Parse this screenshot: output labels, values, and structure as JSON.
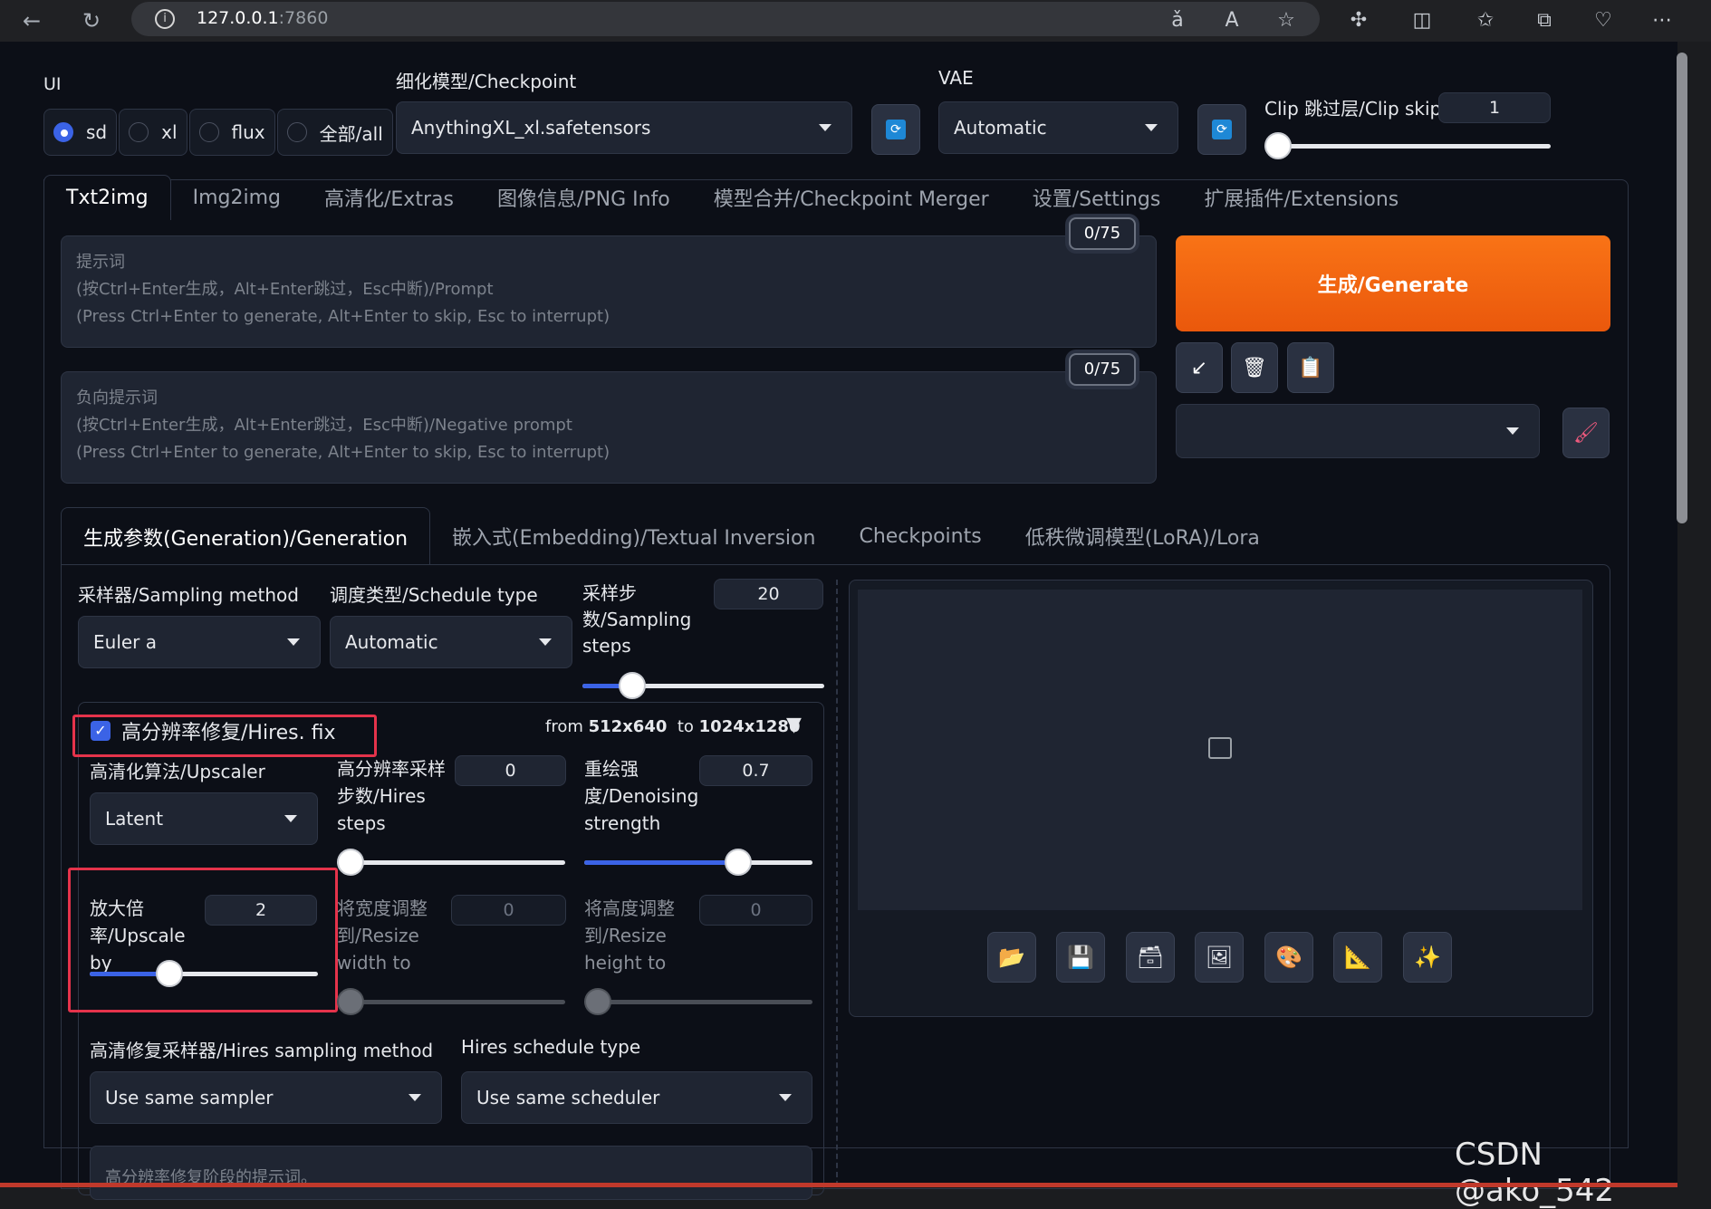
{
  "browser": {
    "url_host": "127.0.0.1",
    "url_port": ":7860",
    "info_icon": "i"
  },
  "header": {
    "ui_label": "UI",
    "ui_options": [
      "sd",
      "xl",
      "flux",
      "全部/all"
    ],
    "checkpoint_label": "细化模型/Checkpoint",
    "checkpoint_value": "AnythingXL_xl.safetensors",
    "vae_label": "VAE",
    "vae_value": "Automatic",
    "clip_label": "Clip 跳过层/Clip skip",
    "clip_value": "1"
  },
  "tabs": [
    "Txt2img",
    "Img2img",
    "高清化/Extras",
    "图像信息/PNG Info",
    "模型合并/Checkpoint Merger",
    "设置/Settings",
    "扩展插件/Extensions"
  ],
  "prompt": {
    "placeholder": "提示词\n(按Ctrl+Enter生成，Alt+Enter跳过，Esc中断)/Prompt\n(Press Ctrl+Enter to generate, Alt+Enter to skip, Esc to interrupt)",
    "token_count": "0/75"
  },
  "negative_prompt": {
    "placeholder": "负向提示词\n(按Ctrl+Enter生成，Alt+Enter跳过，Esc中断)/Negative prompt\n(Press Ctrl+Enter to generate, Alt+Enter to skip, Esc to interrupt)",
    "token_count": "0/75"
  },
  "generate_label": "生成/Generate",
  "subtabs": [
    "生成参数(Generation)/Generation",
    "嵌入式(Embedding)/Textual Inversion",
    "Checkpoints",
    "低秩微调模型(LoRA)/Lora"
  ],
  "generation": {
    "sampler_label": "采样器/Sampling method",
    "sampler_value": "Euler a",
    "schedule_label": "调度类型/Schedule type",
    "schedule_value": "Automatic",
    "steps_label": "采样步数/Sampling steps",
    "steps_value": "20",
    "steps_fraction": 0.17
  },
  "hires": {
    "title": "高分辨率修复/Hires. fix",
    "from_prefix": "from",
    "from_size": "512x640",
    "to_prefix": "to",
    "to_size": "1024x1280",
    "toggle_glyph": "▼",
    "upscaler_label": "高清化算法/Upscaler",
    "upscaler_value": "Latent",
    "steps_label": "高分辨率采样步数/Hires steps",
    "steps_value": "0",
    "steps_fraction": 0.0,
    "denoise_label": "重绘强度/Denoising strength",
    "denoise_value": "0.7",
    "denoise_fraction": 0.7,
    "upscale_label": "放大倍率/Upscale by",
    "upscale_value": "2",
    "upscale_fraction": 0.33,
    "resize_w_label": "将宽度调整到/Resize width to",
    "resize_w_value": "0",
    "resize_h_label": "将高度调整到/Resize height to",
    "resize_h_value": "0",
    "sampler_label": "高清修复采样器/Hires sampling method",
    "sampler_value": "Use same sampler",
    "schedule_label": "Hires schedule type",
    "schedule_value": "Use same scheduler",
    "prompt_placeholder": "高分辨率修复阶段的提示词。"
  },
  "watermark": "CSDN @ako_542",
  "colors": {
    "accent": "#3b63e6",
    "generate": "#f97316",
    "highlight": "#e5334b"
  }
}
